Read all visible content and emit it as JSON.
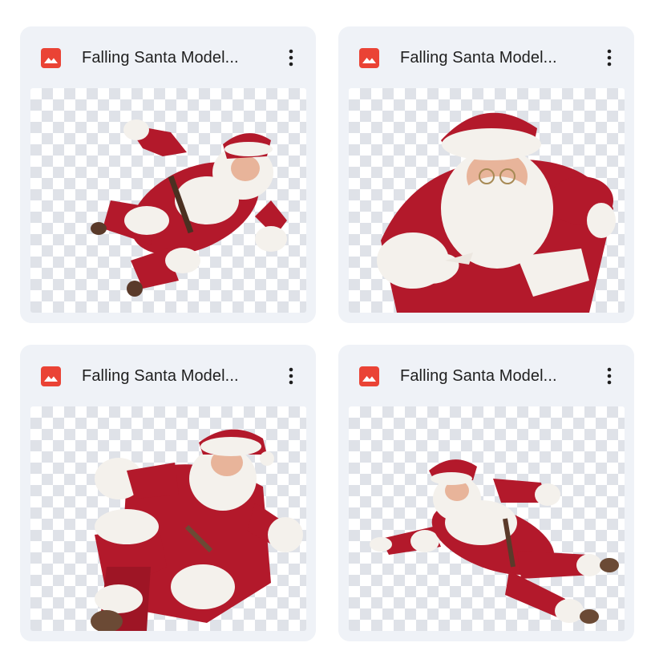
{
  "files": [
    {
      "title": "Falling Santa Model...",
      "type_icon": "image-icon",
      "menu_icon": "more-vert-icon"
    },
    {
      "title": "Falling Santa Model...",
      "type_icon": "image-icon",
      "menu_icon": "more-vert-icon"
    },
    {
      "title": "Falling Santa Model...",
      "type_icon": "image-icon",
      "menu_icon": "more-vert-icon"
    },
    {
      "title": "Falling Santa Model...",
      "type_icon": "image-icon",
      "menu_icon": "more-vert-icon"
    }
  ],
  "colors": {
    "card_background": "#eff2f7",
    "image_icon": "#ea4335",
    "title_text": "#1f1f1f",
    "checker_dark": "#dfe2e8",
    "checker_light": "#ffffff",
    "santa_red": "#b3192b",
    "santa_fur": "#f4f1ec",
    "santa_skin": "#e8b49a"
  }
}
